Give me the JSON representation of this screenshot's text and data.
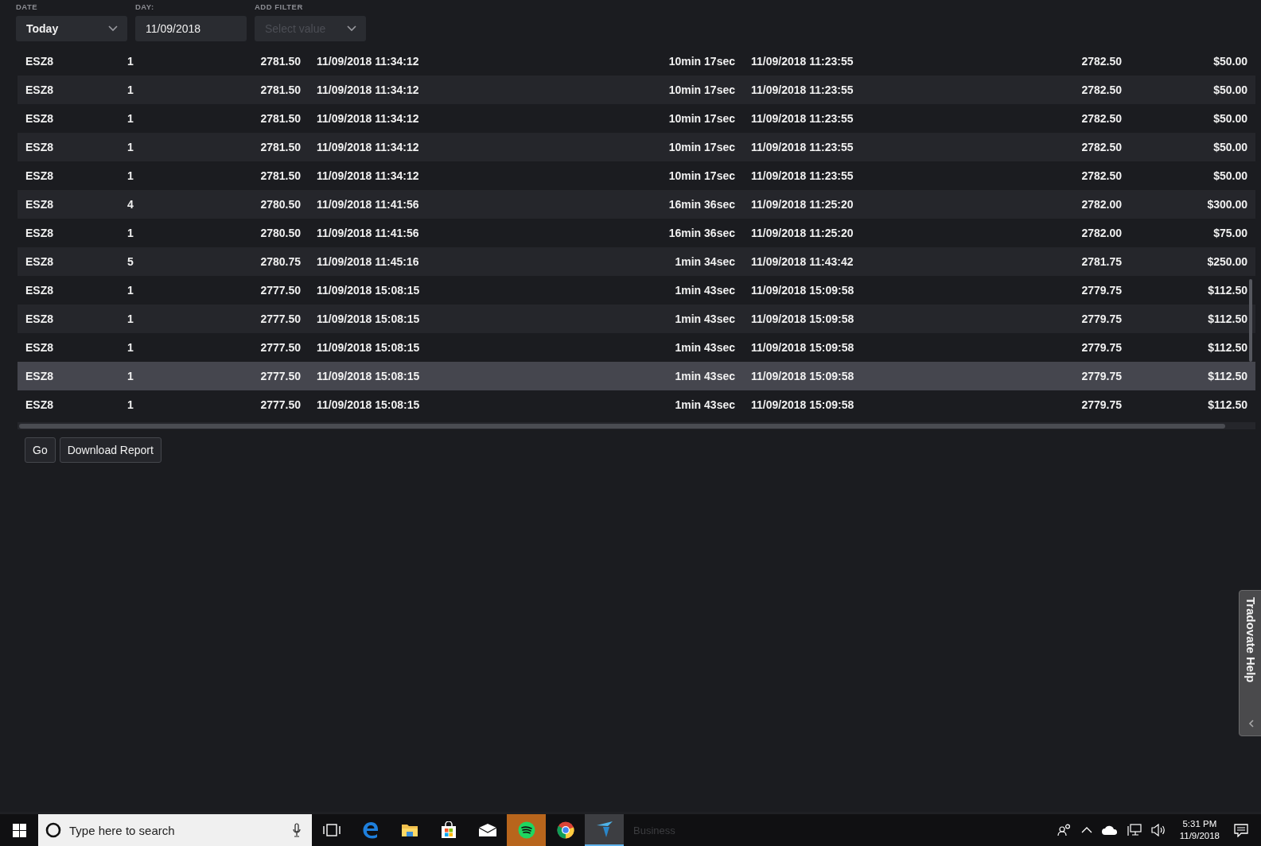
{
  "filters": [
    {
      "label": "DATE",
      "kind": "select",
      "value": "Today"
    },
    {
      "label": "DAY:",
      "kind": "input",
      "value": "11/09/2018"
    },
    {
      "label": "ADD FILTER",
      "kind": "select",
      "placeholder": "Select value"
    }
  ],
  "table": {
    "rows": [
      {
        "cells": [
          "ESZ8",
          "1",
          "2781.50",
          "11/09/2018 11:34:12",
          "10min 17sec",
          "11/09/2018 11:23:55",
          "2782.50",
          "$50.00"
        ],
        "selected": false
      },
      {
        "cells": [
          "ESZ8",
          "1",
          "2781.50",
          "11/09/2018 11:34:12",
          "10min 17sec",
          "11/09/2018 11:23:55",
          "2782.50",
          "$50.00"
        ],
        "selected": false
      },
      {
        "cells": [
          "ESZ8",
          "1",
          "2781.50",
          "11/09/2018 11:34:12",
          "10min 17sec",
          "11/09/2018 11:23:55",
          "2782.50",
          "$50.00"
        ],
        "selected": false
      },
      {
        "cells": [
          "ESZ8",
          "1",
          "2781.50",
          "11/09/2018 11:34:12",
          "10min 17sec",
          "11/09/2018 11:23:55",
          "2782.50",
          "$50.00"
        ],
        "selected": false
      },
      {
        "cells": [
          "ESZ8",
          "1",
          "2781.50",
          "11/09/2018 11:34:12",
          "10min 17sec",
          "11/09/2018 11:23:55",
          "2782.50",
          "$50.00"
        ],
        "selected": false
      },
      {
        "cells": [
          "ESZ8",
          "4",
          "2780.50",
          "11/09/2018 11:41:56",
          "16min 36sec",
          "11/09/2018 11:25:20",
          "2782.00",
          "$300.00"
        ],
        "selected": false
      },
      {
        "cells": [
          "ESZ8",
          "1",
          "2780.50",
          "11/09/2018 11:41:56",
          "16min 36sec",
          "11/09/2018 11:25:20",
          "2782.00",
          "$75.00"
        ],
        "selected": false
      },
      {
        "cells": [
          "ESZ8",
          "5",
          "2780.75",
          "11/09/2018 11:45:16",
          "1min 34sec",
          "11/09/2018 11:43:42",
          "2781.75",
          "$250.00"
        ],
        "selected": false
      },
      {
        "cells": [
          "ESZ8",
          "1",
          "2777.50",
          "11/09/2018 15:08:15",
          "1min 43sec",
          "11/09/2018 15:09:58",
          "2779.75",
          "$112.50"
        ],
        "selected": false
      },
      {
        "cells": [
          "ESZ8",
          "1",
          "2777.50",
          "11/09/2018 15:08:15",
          "1min 43sec",
          "11/09/2018 15:09:58",
          "2779.75",
          "$112.50"
        ],
        "selected": false
      },
      {
        "cells": [
          "ESZ8",
          "1",
          "2777.50",
          "11/09/2018 15:08:15",
          "1min 43sec",
          "11/09/2018 15:09:58",
          "2779.75",
          "$112.50"
        ],
        "selected": false
      },
      {
        "cells": [
          "ESZ8",
          "1",
          "2777.50",
          "11/09/2018 15:08:15",
          "1min 43sec",
          "11/09/2018 15:09:58",
          "2779.75",
          "$112.50"
        ],
        "selected": true
      },
      {
        "cells": [
          "ESZ8",
          "1",
          "2777.50",
          "11/09/2018 15:08:15",
          "1min 43sec",
          "11/09/2018 15:09:58",
          "2779.75",
          "$112.50"
        ],
        "selected": false
      }
    ]
  },
  "buttons": [
    "Go",
    "Download Report"
  ],
  "help_tab": {
    "label": "Tradovate Help"
  },
  "taskbar": {
    "search": {
      "placeholder": "Type here to search"
    },
    "apps": [
      {
        "kind": "taskview",
        "active": false,
        "flashing": false
      },
      {
        "kind": "edge",
        "active": false,
        "flashing": false
      },
      {
        "kind": "explorer",
        "active": false,
        "flashing": false
      },
      {
        "kind": "store",
        "active": false,
        "flashing": false
      },
      {
        "kind": "mail",
        "active": false,
        "flashing": false
      },
      {
        "kind": "spotify",
        "active": false,
        "flashing": true
      },
      {
        "kind": "chrome",
        "active": false,
        "flashing": false
      },
      {
        "kind": "tradovate",
        "active": true,
        "flashing": false
      }
    ],
    "ghost_text": "Business",
    "time": "5:31 PM",
    "date": "11/9/2018"
  }
}
